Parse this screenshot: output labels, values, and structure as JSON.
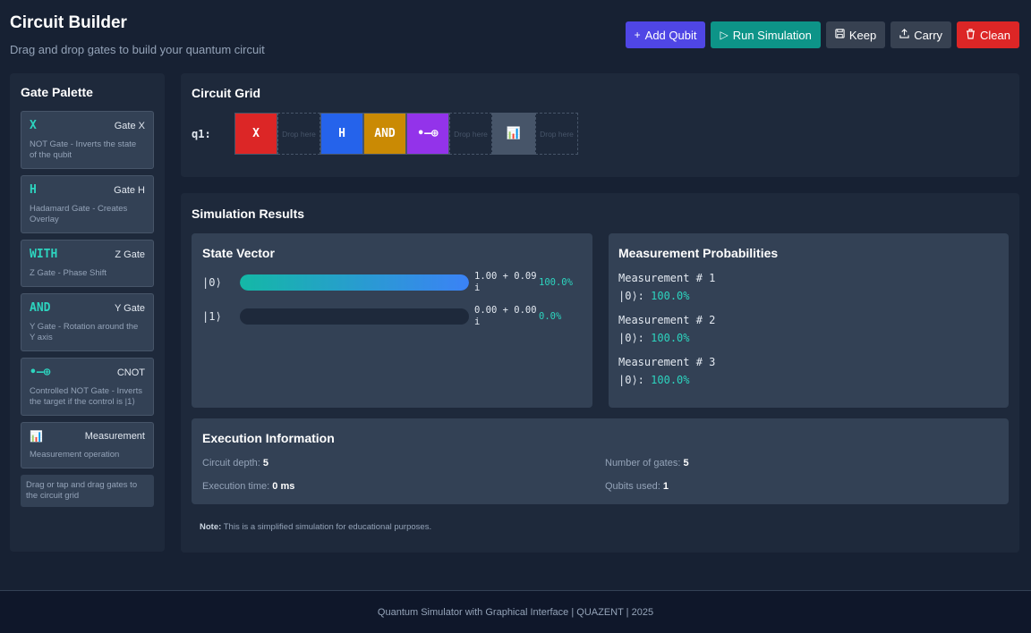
{
  "header": {
    "title": "Circuit Builder",
    "subtitle": "Drag and drop gates to build your quantum circuit"
  },
  "toolbar": {
    "add_qubit": "Add Qubit",
    "run_simulation": "Run Simulation",
    "keep": "Keep",
    "carry": "Carry",
    "clean": "Clean"
  },
  "palette": {
    "title": "Gate Palette",
    "gates": [
      {
        "symbol": "X",
        "name": "Gate X",
        "desc": "NOT Gate - Inverts the state of the qubit"
      },
      {
        "symbol": "H",
        "name": "Gate H",
        "desc": "Hadamard Gate - Creates Overlay"
      },
      {
        "symbol": "WITH",
        "name": "Z Gate",
        "desc": "Z Gate - Phase Shift"
      },
      {
        "symbol": "AND",
        "name": "Y Gate",
        "desc": "Y Gate - Rotation around the Y axis"
      },
      {
        "symbol": "•—⊕",
        "name": "CNOT",
        "desc": "Controlled NOT Gate - Inverts the target if the control is |1⟩"
      },
      {
        "symbol": "📊",
        "name": "Measurement",
        "desc": "Measurement operation"
      }
    ],
    "hint": "Drag or tap and drag gates to the circuit grid"
  },
  "circuit": {
    "title": "Circuit Grid",
    "qubit_label": "q1:",
    "slots": [
      {
        "label": "X"
      },
      {
        "label": "Drop here"
      },
      {
        "label": "H"
      },
      {
        "label": "AND"
      },
      {
        "label": "•—⊕"
      },
      {
        "label": "Drop here"
      },
      {
        "label": "📊"
      },
      {
        "label": "Drop here"
      }
    ]
  },
  "results": {
    "title": "Simulation Results",
    "state_vector": {
      "title": "State Vector",
      "states": [
        {
          "ket": "|0⟩",
          "amplitude": "1.00 + 0.09 i",
          "probability": "100.0%",
          "fraction": 1.0
        },
        {
          "ket": "|1⟩",
          "amplitude": "0.00 + 0.00 i",
          "probability": "0.0%",
          "fraction": 0.0
        }
      ]
    },
    "measurement": {
      "title": "Measurement Probabilities",
      "items": [
        {
          "heading": "Measurement # 1",
          "state": "|0⟩:",
          "value": "100.0%"
        },
        {
          "heading": "Measurement # 2",
          "state": "|0⟩:",
          "value": "100.0%"
        },
        {
          "heading": "Measurement # 3",
          "state": "|0⟩:",
          "value": "100.0%"
        }
      ]
    },
    "execution": {
      "title": "Execution Information",
      "depth_label": "Circuit depth:",
      "depth": "5",
      "gates_label": "Number of gates:",
      "gates": "5",
      "time_label": "Execution time:",
      "time": "0 ms",
      "qubits_label": "Qubits used:",
      "qubits": "1"
    },
    "note_label": "Note:",
    "note": "This is a simplified simulation for educational purposes."
  },
  "footer": {
    "text": "Quantum Simulator with Graphical Interface | QUAZENT | 2025"
  },
  "colors": {
    "accent": "#2dd4bf",
    "add": "#4f46e5",
    "run": "#0d9488",
    "clean": "#dc2626",
    "gate_x": "#dc2626",
    "gate_h": "#2563eb",
    "gate_and": "#ca8a04",
    "gate_cnot": "#9333ea"
  }
}
